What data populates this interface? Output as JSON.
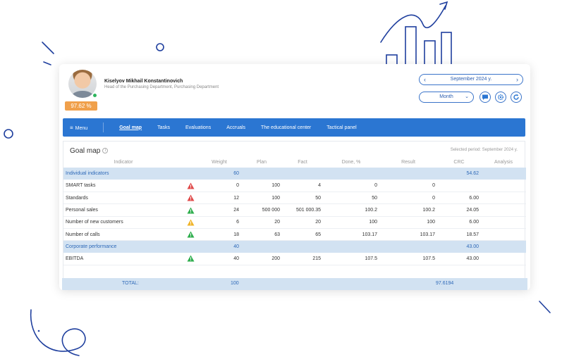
{
  "user": {
    "name": "Kiselyov Mikhail Konstantinovich",
    "role": "Head of the Purchasing Department, Purchasing Department",
    "percent": "97.62 %"
  },
  "controls": {
    "period": "September 2024 y.",
    "period_prev": "‹",
    "period_next": "›",
    "month": "Month",
    "month_caret": "⌄"
  },
  "nav": {
    "menu_icon": "≡",
    "menu": "Menu",
    "items": [
      "Goal map",
      "Tasks",
      "Evaluations",
      "Accruals",
      "The educational center",
      "Tactical panel"
    ]
  },
  "panel": {
    "title": "Goal map",
    "info": "i",
    "selected_period": "Selected period: September 2024 y."
  },
  "columns": [
    "Indicator",
    "Weight",
    "Plan",
    "Fact",
    "Done, %",
    "Result",
    "CRC",
    "Analysis"
  ],
  "groups": [
    {
      "label": "Individual indicators",
      "weight": "60",
      "crc": "54.62",
      "rows": [
        {
          "name": "SMART tasks",
          "status": "red",
          "weight": "0",
          "plan": "100",
          "fact": "4",
          "done": "0",
          "result": "0",
          "crc": ""
        },
        {
          "name": "Standards",
          "status": "red",
          "weight": "12",
          "plan": "100",
          "fact": "50",
          "done": "50",
          "result": "0",
          "crc": "6.00"
        },
        {
          "name": "Personal sales",
          "status": "green",
          "weight": "24",
          "plan": "500 000",
          "fact": "501 000.35",
          "done": "100.2",
          "result": "100.2",
          "crc": "24.05"
        },
        {
          "name": "Number of new customers",
          "status": "yellow",
          "weight": "6",
          "plan": "20",
          "fact": "20",
          "done": "100",
          "result": "100",
          "crc": "6.00"
        },
        {
          "name": "Number of calls",
          "status": "green",
          "weight": "18",
          "plan": "63",
          "fact": "65",
          "done": "103.17",
          "result": "103.17",
          "crc": "18.57"
        }
      ]
    },
    {
      "label": "Corporate performance",
      "weight": "40",
      "crc": "43.00",
      "rows": [
        {
          "name": "EBITDA",
          "status": "green",
          "weight": "40",
          "plan": "200",
          "fact": "215",
          "done": "107.5",
          "result": "107.5",
          "crc": "43.00"
        }
      ]
    }
  ],
  "total": {
    "label": "TOTAL:",
    "weight": "100",
    "crc": "97.6194"
  },
  "colors": {
    "accent": "#2b76d2",
    "group_bg": "#d2e2f2",
    "badge": "#f0a04b",
    "red": "#e04b4b",
    "green": "#2fae4e",
    "yellow": "#f0b429"
  }
}
